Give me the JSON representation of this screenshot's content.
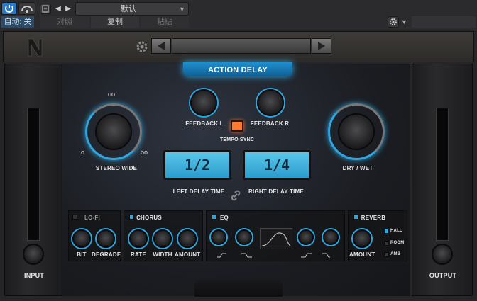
{
  "host": {
    "preset_name": "默认",
    "auto_label": "自动: 关",
    "compare_label": "对照",
    "copy_label": "复制",
    "paste_label": "粘贴"
  },
  "plugin": {
    "title": "ACTION DELAY",
    "knobs": {
      "feedback_l": "FEEDBACK L",
      "feedback_r": "FEEDBACK R",
      "tempo_sync": "TEMPO SYNC",
      "stereo_wide": "STEREO WIDE",
      "dry_wet": "DRY / WET"
    },
    "delay": {
      "left_value": "1/2",
      "right_value": "1/4",
      "left_label": "LEFT DELAY TIME",
      "right_label": "RIGHT DELAY TIME"
    },
    "input_label": "INPUT",
    "output_label": "OUTPUT",
    "sections": {
      "lofi": {
        "title": "LO-FI",
        "bit": "BIT",
        "degrade": "DEGRADE"
      },
      "chorus": {
        "title": "CHORUS",
        "rate": "RATE",
        "width": "WIDTH",
        "amount": "AMOUNT"
      },
      "eq": {
        "title": "EQ"
      },
      "reverb": {
        "title": "REVERB",
        "amount": "AMOUNT",
        "hall": "HALL",
        "room": "ROOM",
        "amb": "AMB"
      }
    }
  },
  "colors": {
    "accent": "#2ea7e0",
    "led_orange": "#ff7a2e"
  }
}
